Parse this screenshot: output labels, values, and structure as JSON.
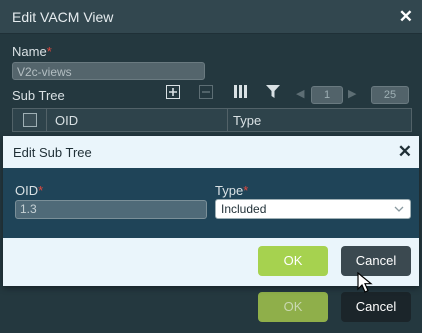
{
  "outer_dialog": {
    "title": "Edit VACM View",
    "name_label": "Name",
    "name_value": "V2c-views",
    "subtree_label": "Sub Tree",
    "pager": {
      "page": "1",
      "page_size": "25"
    },
    "grid": {
      "columns": [
        "OID",
        "Type"
      ]
    },
    "ok_label": "OK",
    "cancel_label": "Cancel"
  },
  "inner_dialog": {
    "title": "Edit Sub Tree",
    "oid_label": "OID",
    "oid_value": "1.3",
    "type_label": "Type",
    "type_value": "Included",
    "ok_label": "OK",
    "cancel_label": "Cancel"
  },
  "colors": {
    "ok_button": "#a6d24f",
    "cancel_button": "#3b4950",
    "required_mark": "#e0483e"
  }
}
